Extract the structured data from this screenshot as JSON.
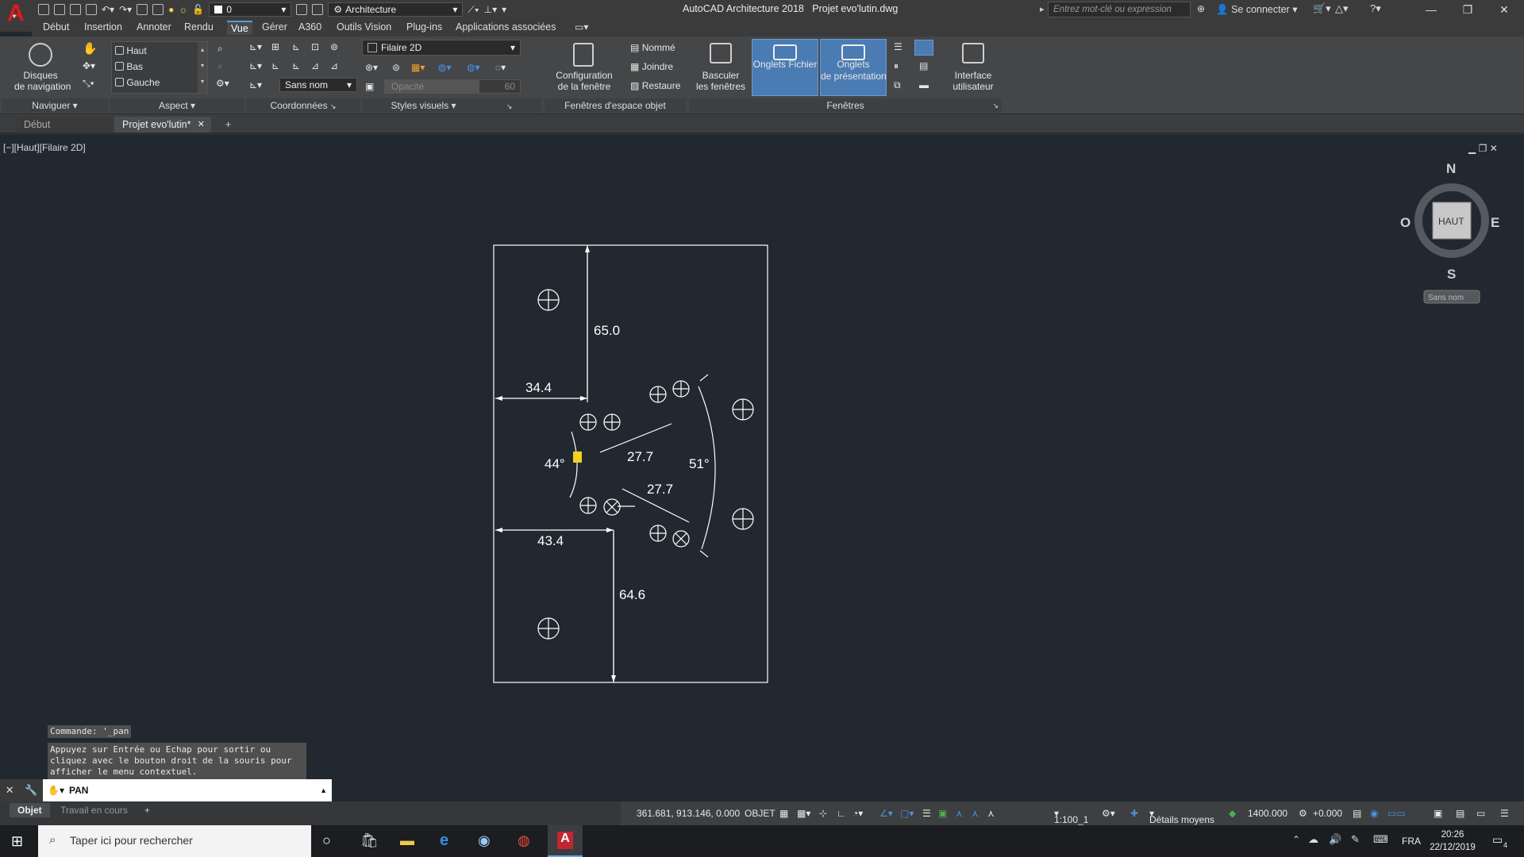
{
  "app": {
    "title": "AutoCAD Architecture 2018",
    "document": "Projet evo'lutin.dwg",
    "logo_letter": "A",
    "workspace": "Architecture",
    "layer_value": "0",
    "search_placeholder": "Entrez mot-clé ou expression",
    "signin": "Se connecter"
  },
  "menu_tabs": [
    "Début",
    "Insertion",
    "Annoter",
    "Rendu",
    "Vue",
    "Gérer",
    "A360",
    "Outils Vision",
    "Plug-ins",
    "Applications associées"
  ],
  "active_menu_tab": "Vue",
  "ribbon": {
    "navigate": {
      "disks_label_1": "Disques",
      "disks_label_2": "de navigation",
      "panel": "Naviguer"
    },
    "views": {
      "items": [
        "Haut",
        "Bas",
        "Gauche"
      ],
      "panel": "Aspect"
    },
    "coords": {
      "ucs": "Sans nom",
      "panel": "Coordonnées"
    },
    "visual": {
      "style": "Filaire 2D",
      "opacity_label": "Opacité",
      "opacity_value": "60",
      "panel": "Styles visuels"
    },
    "viewports": {
      "config_1": "Configuration",
      "config_2": "de la fenêtre",
      "named": "Nommé",
      "join": "Joindre",
      "restore": "Restaure",
      "panel": "Fenêtres d'espace objet"
    },
    "windows": {
      "switch_1": "Basculer",
      "switch_2": "les fenêtres",
      "file_tabs": "Onglets Fichier",
      "layout_tabs_1": "Onglets",
      "layout_tabs_2": "de présentation",
      "ui_1": "Interface",
      "ui_2": "utilisateur",
      "panel": "Fenêtres"
    }
  },
  "file_tabs": [
    {
      "label": "Début"
    },
    {
      "label": "Projet evo'lutin*"
    }
  ],
  "viewport_label": "[−][Haut][Filaire 2D]",
  "viewcube": {
    "n": "N",
    "s": "S",
    "e": "E",
    "w": "O",
    "face": "HAUT",
    "ucs": "Sans nom"
  },
  "dimensions": [
    "65.0",
    "34.4",
    "27.7",
    "44°",
    "51°",
    "27.7",
    "43.4",
    "64.6"
  ],
  "command": {
    "history": [
      "Commande: '_pan",
      "Appuyez sur Entrée ou Echap pour sortir ou",
      "cliquez avec le bouton droit de la souris pour",
      "afficher le menu contextuel."
    ],
    "current": "PAN"
  },
  "layout_tabs": [
    "Objet",
    "Travail en cours"
  ],
  "status": {
    "coords": "361.681, 913.146, 0.000",
    "mode": "OBJET",
    "scale": "1:100_1",
    "detail": "Détails moyens",
    "elevation": "1400.000",
    "offset": "+0.000"
  },
  "taskbar": {
    "search": "Taper ici pour rechercher",
    "lang": "FRA",
    "time": "20:26",
    "date": "22/12/2019",
    "notifications": "4"
  }
}
